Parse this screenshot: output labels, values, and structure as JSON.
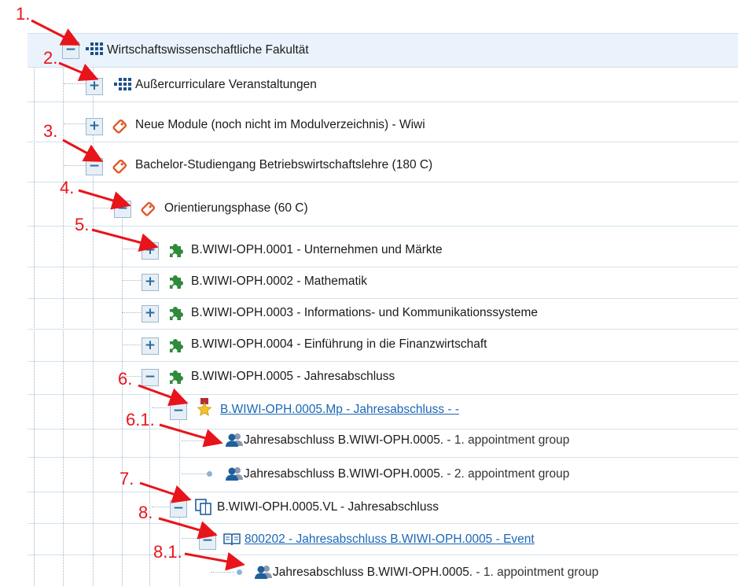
{
  "tree": {
    "nodes": [
      {
        "toggle": "−",
        "icon": "faculty-grid-icon",
        "label": "Wirtschaftswissenschaftliche Fakultät",
        "highlight": true
      },
      {
        "toggle": "+",
        "icon": "faculty-grid-icon",
        "label": "Außercurriculare Veranstaltungen"
      },
      {
        "toggle": "+",
        "icon": "tag-icon",
        "label": "Neue Module (noch nicht im Modulverzeichnis) - Wiwi"
      },
      {
        "toggle": "−",
        "icon": "tag-icon",
        "label": "Bachelor-Studiengang Betriebswirtschaftslehre (180 C)"
      },
      {
        "toggle": "−",
        "icon": "tag-icon",
        "label": "Orientierungsphase (60 C)"
      },
      {
        "toggle": "+",
        "icon": "puzzle-icon",
        "label": "B.WIWI-OPH.0001 - Unternehmen und Märkte"
      },
      {
        "toggle": "+",
        "icon": "puzzle-icon",
        "label": "B.WIWI-OPH.0002 - Mathematik"
      },
      {
        "toggle": "+",
        "icon": "puzzle-icon",
        "label": "B.WIWI-OPH.0003 - Informations- und Kommunikationssysteme"
      },
      {
        "toggle": "+",
        "icon": "puzzle-icon",
        "label": "B.WIWI-OPH.0004 - Einführung in die Finanzwirtschaft"
      },
      {
        "toggle": "−",
        "icon": "puzzle-icon",
        "label": "B.WIWI-OPH.0005 - Jahresabschluss"
      },
      {
        "toggle": "−",
        "icon": "exam-star-icon",
        "label": "B.WIWI-OPH.0005.Mp - Jahresabschluss - -",
        "link": true
      },
      {
        "icon": "group-icon",
        "label": "Jahresabschluss B.WIWI-OPH.0005.",
        "suffix": " - 1. appointment group"
      },
      {
        "icon": "group-icon",
        "label": "Jahresabschluss B.WIWI-OPH.0005.",
        "suffix": " - 2. appointment group"
      },
      {
        "toggle": "−",
        "icon": "course-copy-icon",
        "label": "B.WIWI-OPH.0005.VL - Jahresabschluss"
      },
      {
        "toggle": "−",
        "icon": "book-icon",
        "label": "800202 - Jahresabschluss B.WIWI-OPH.0005 - Event",
        "link": true
      },
      {
        "icon": "group-icon",
        "label": "Jahresabschluss B.WIWI-OPH.0005.",
        "suffix": " - 1. appointment group"
      }
    ]
  },
  "annotations": {
    "labels": [
      "1.",
      "2.",
      "3.",
      "4.",
      "5.",
      "6.",
      "6.1.",
      "7.",
      "8.",
      "8.1."
    ],
    "color": "#e8141b"
  },
  "colors": {
    "link": "#1b67b8",
    "toggle_bg": "#e6eff6",
    "row_highlight": "#eaf3fb",
    "puzzle": "#2e8b3a",
    "tag": "#e05a2a",
    "person": "#2a6aa0"
  }
}
